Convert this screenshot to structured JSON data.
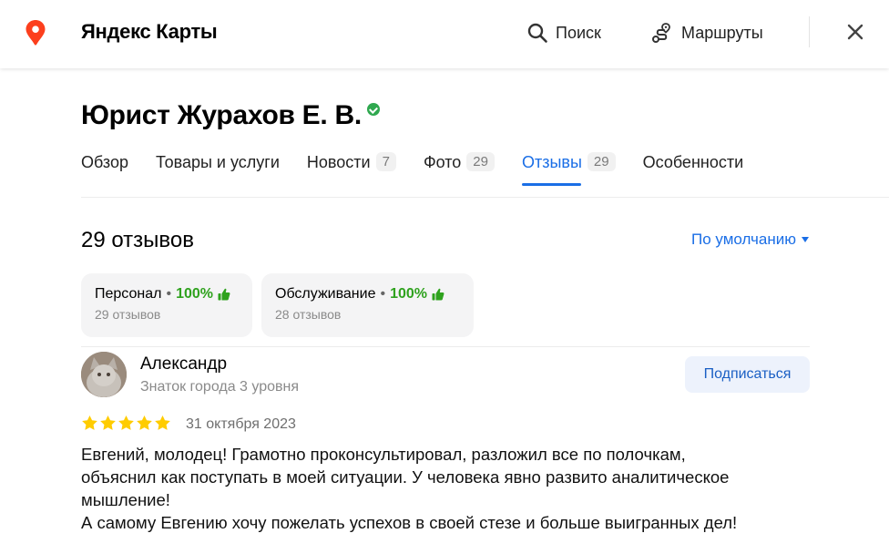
{
  "header": {
    "brand": "Яндекс Карты",
    "search_label": "Поиск",
    "routes_label": "Маршруты",
    "icons": [
      "map-pin-icon",
      "search-icon",
      "route-icon",
      "close-icon"
    ],
    "accent_color": "#fc3f1d"
  },
  "organization": {
    "title": "Юрист Журахов Е. В.",
    "verified_color": "#2fa84f"
  },
  "tabs": [
    {
      "label": "Обзор",
      "count": ""
    },
    {
      "label": "Товары и услуги",
      "count": ""
    },
    {
      "label": "Новости",
      "count": "7"
    },
    {
      "label": "Фото",
      "count": "29"
    },
    {
      "label": "Отзывы",
      "count": "29",
      "active": true
    },
    {
      "label": "Особенности",
      "count": ""
    }
  ],
  "reviews": {
    "count_title": "29 отзывов",
    "sort_label": "По умолчанию",
    "aspects": [
      {
        "name": "Персонал",
        "percent": "100%",
        "sub": "29 отзывов"
      },
      {
        "name": "Обслуживание",
        "percent": "100%",
        "sub": "28 отзывов"
      }
    ],
    "items": [
      {
        "author": "Александр",
        "level": "Знаток города 3 уровня",
        "subscribe_label": "Подписаться",
        "rating": 5,
        "date": "31 октября 2023",
        "text_lines": [
          "Евгений, молодец! Грамотно проконсультировал, разложил все по полочкам,",
          "объяснил как поступать в моей ситуации. У человека явно развито аналитическое",
          "мышление!",
          "А самому Евгению хочу пожелать успехов в своей стезе и больше выигранных дел!"
        ]
      }
    ]
  },
  "colors": {
    "link_blue": "#1a6ee6",
    "star_gold": "#fc0",
    "positive_green": "#2fa21e"
  }
}
